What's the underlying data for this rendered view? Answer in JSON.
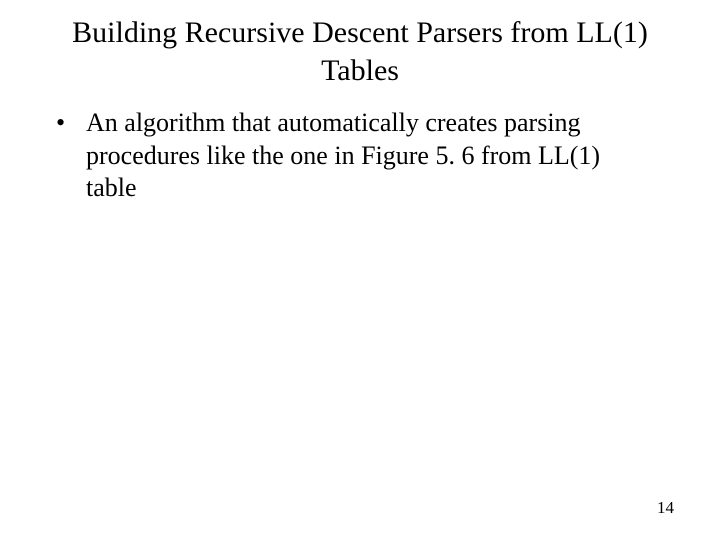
{
  "slide": {
    "title": "Building Recursive Descent Parsers from LL(1) Tables",
    "bullets": [
      {
        "text": "An algorithm that automatically creates parsing procedures like the one in Figure 5. 6 from LL(1) table"
      }
    ],
    "page_number": "14"
  }
}
